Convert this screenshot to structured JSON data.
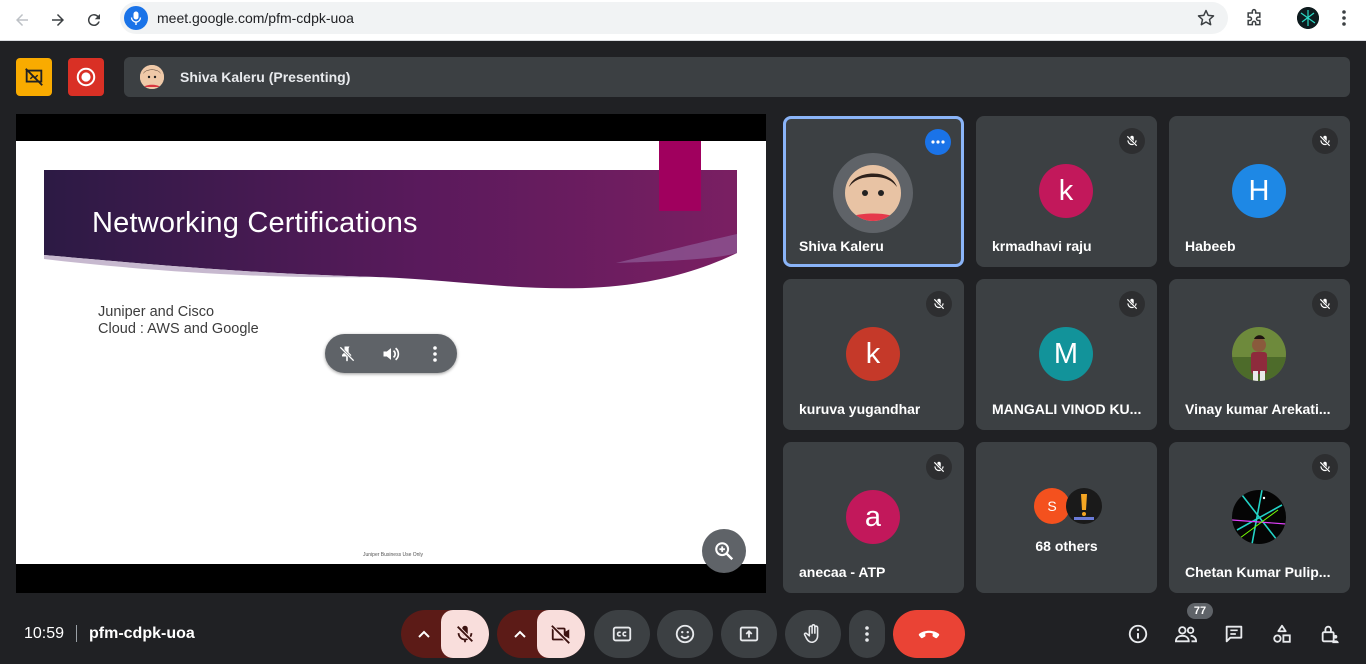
{
  "browser": {
    "url": "meet.google.com/pfm-cdpk-uoa"
  },
  "topbar": {
    "presenter_label": "Shiva Kaleru (Presenting)"
  },
  "slide": {
    "title": "Networking Certifications",
    "bullets": [
      "Juniper and Cisco",
      "Cloud : AWS and Google"
    ],
    "footer": "Juniper Business Use Only"
  },
  "tiles": [
    {
      "name": "Shiva Kaleru",
      "avatar_type": "photo",
      "muted": false,
      "active": true
    },
    {
      "name": "krmadhavi raju",
      "avatar_letter": "k",
      "avatar_color": "#c2185b",
      "muted": true
    },
    {
      "name": "Habeeb",
      "avatar_letter": "H",
      "avatar_color": "#1e88e5",
      "muted": true
    },
    {
      "name": "kuruva yugandhar",
      "avatar_letter": "k",
      "avatar_color": "#c53929",
      "muted": true
    },
    {
      "name": "MANGALI VINOD KU...",
      "avatar_letter": "M",
      "avatar_color": "#12939a",
      "muted": true
    },
    {
      "name": "Vinay kumar Arekati...",
      "avatar_type": "photo",
      "muted": true
    },
    {
      "name": "anecaa - ATP",
      "avatar_letter": "a",
      "avatar_color": "#c2185b",
      "muted": true
    },
    {
      "others_label": "68 others",
      "others_letter": "S",
      "others_color": "#f4511e"
    },
    {
      "name": "Chetan Kumar Pulip...",
      "avatar_type": "photo",
      "muted": true
    }
  ],
  "bottombar": {
    "time": "10:59",
    "meeting_code": "pfm-cdpk-uoa",
    "participant_count": "77"
  },
  "colors": {
    "accent": "#8ab4f8",
    "danger": "#ea4335",
    "surface": "#3c4043",
    "background": "#202124"
  }
}
